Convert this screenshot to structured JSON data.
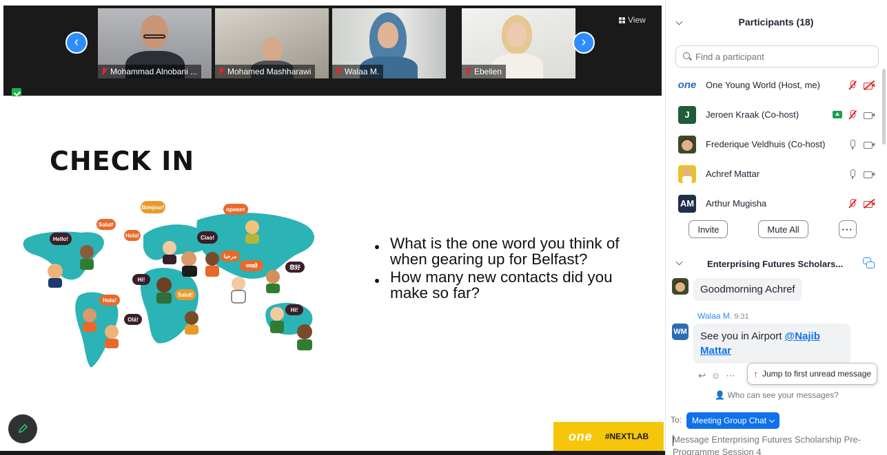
{
  "video_strip": {
    "view_label": "View",
    "tiles": [
      {
        "name": "Mohammad Alnobani ..."
      },
      {
        "name": "Mohamed Mashharawi"
      },
      {
        "name": "Walaa M."
      },
      {
        "name": "Ebelien"
      }
    ]
  },
  "slide": {
    "title": "CHECK IN",
    "questions": [
      "What is the one word you think of when gearing up for Belfast?",
      "How many new contacts did you make so far?"
    ],
    "logo_one": "one",
    "logo_nextlab": "#NEXTLAB"
  },
  "participants": {
    "title": "Participants (18)",
    "search_placeholder": "Find a participant",
    "list": [
      {
        "name": "One Young World (Host, me)",
        "avatar_text": "one",
        "avatar_color": "#ffffff",
        "mic": "off",
        "cam": "off"
      },
      {
        "name": "Jeroen Kraak (Co-host)",
        "avatar_text": "J",
        "avatar_color": "#1f5c3a",
        "mic": "off",
        "cam": "on",
        "sharing": true
      },
      {
        "name": "Frederique Veldhuis (Co-host)",
        "avatar_text": "",
        "avatar_color": "#3d4a2a",
        "mic": "on",
        "cam": "on"
      },
      {
        "name": "Achref Mattar",
        "avatar_text": "",
        "avatar_color": "#e8c22e",
        "mic": "on",
        "cam": "on"
      },
      {
        "name": "Arthur Mugisha",
        "avatar_text": "AM",
        "avatar_color": "#1f2f4a",
        "mic": "off",
        "cam": "off"
      }
    ],
    "invite_label": "Invite",
    "mute_all_label": "Mute All",
    "more_label": "···"
  },
  "chat": {
    "title": "Enterprising Futures Scholars...",
    "messages": [
      {
        "sender": "",
        "time": "",
        "text": "Goodmorning Achref"
      },
      {
        "sender": "Walaa M.",
        "avatar_text": "WM",
        "time": "9:31",
        "text": "See you in Airport ",
        "mention": "@Najib Mattar"
      }
    ],
    "jump_label": "Jump to first unread message",
    "who_can_see": "Who can see your messages?",
    "to_label": "To:",
    "recipient": "Meeting Group Chat",
    "input_placeholder": "Message Enterprising Futures Scholarship Pre-Programme Session 4"
  },
  "colors": {
    "accent": "#2d8cff",
    "muted_red": "#e02828",
    "slide_yellow": "#f5c60a",
    "map_teal": "#2bb3b5"
  }
}
